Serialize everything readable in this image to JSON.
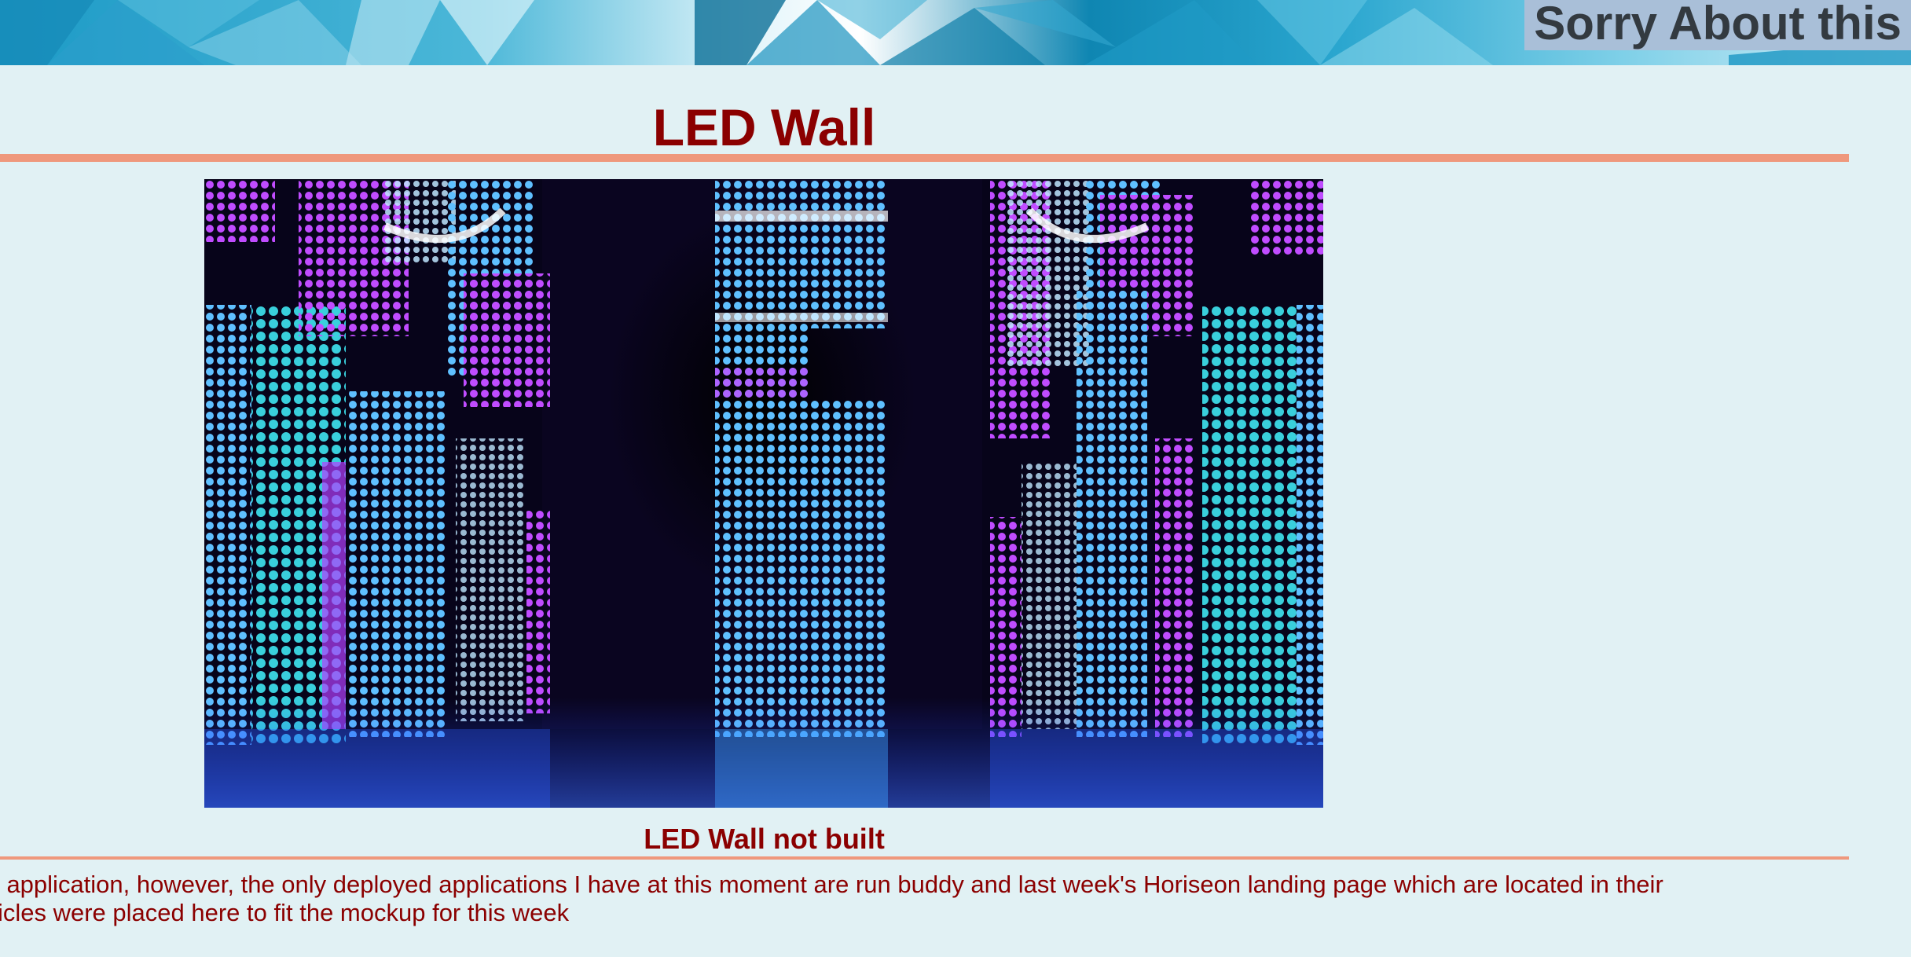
{
  "header": {
    "title": "Sorry About this"
  },
  "main": {
    "heading": "LED Wall",
    "image_alt": "LED wall panels glowing blue and purple",
    "caption": "LED Wall not built",
    "body_lines": [
      "deployed application, however, the only deployed applications I have at this moment are run buddy and last week's Horiseon landing page which are located in their",
      "mpty\" articles were placed here to fit the mockup for this week"
    ]
  },
  "colors": {
    "background": "#e1f1f4",
    "heading_text": "#8b0000",
    "rule": "#ef987c",
    "header_title_bg": "#a9bfd8",
    "header_title_text": "#333a40"
  }
}
